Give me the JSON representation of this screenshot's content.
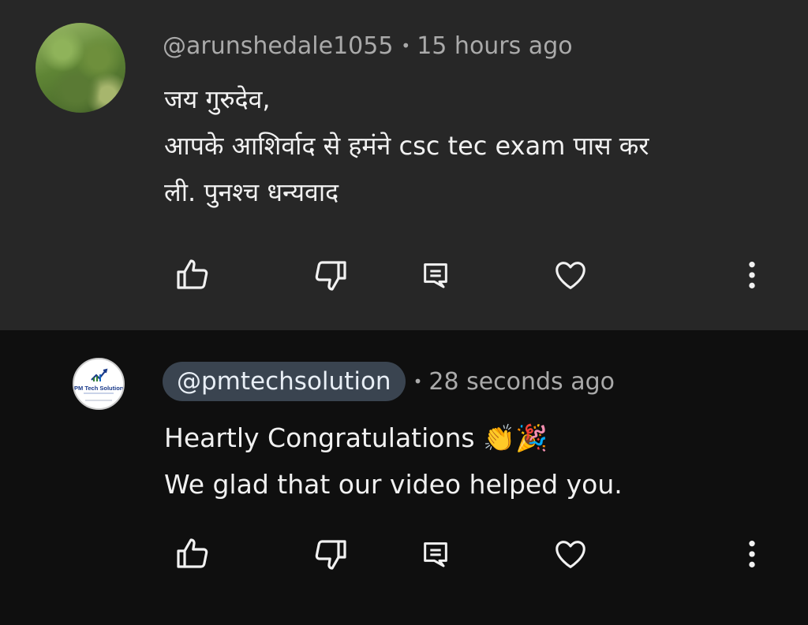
{
  "comments": [
    {
      "handle": "@arunshedale1055",
      "time": "15 hours ago",
      "lines": [
        "जय गुरुदेव,",
        "आपके आशिर्वाद से हमंने csc tec exam पास कर",
        "ली. पुनश्च धन्यवाद"
      ],
      "icons": [
        "thumb-up-icon",
        "thumb-down-icon",
        "reply-icon",
        "heart-icon",
        "more-vertical-icon"
      ]
    },
    {
      "handle": "@pmtechsolution",
      "time": "28 seconds ago",
      "logo_text": "PM Tech Solution",
      "lines": [
        "Heartly Congratulations 👏🎉",
        "We glad that our video helped you."
      ],
      "icons": [
        "thumb-up-icon",
        "thumb-down-icon",
        "reply-icon",
        "heart-icon",
        "more-vertical-icon"
      ]
    }
  ],
  "colors": {
    "background_top": "#272727",
    "background_bottom": "#0f0f0f",
    "text": "#f1f1f1",
    "meta": "#aaaaaa",
    "handle_pill": "#3a4450"
  }
}
